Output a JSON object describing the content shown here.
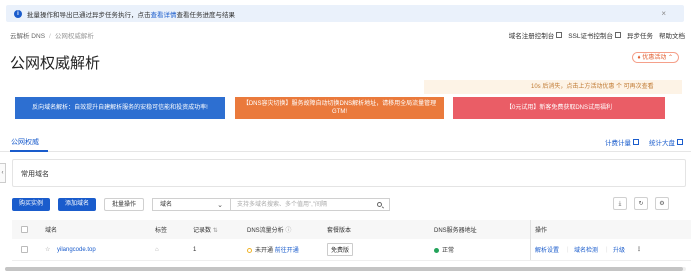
{
  "notice": {
    "text": "批量操作和导出已通过异步任务执行，点击",
    "link": "查看详情",
    "suffix": "查看任务进度与结果",
    "close": "×"
  },
  "breadcrumb": {
    "root": "云解析 DNS",
    "sep": "/",
    "current": "公网权威解析"
  },
  "top_links": [
    "域名注册控制台",
    "SSL证书控制台",
    "异步任务",
    "帮助文档"
  ],
  "page_title": "公网权威解析",
  "promo_badge": "优惠活动",
  "countdown": "10s 后消失，点击上方活动优惠 个 可再次查看",
  "banners": [
    "反向域名解析：自效提升自建解析服务的安稳可信能和投资成功率!",
    "【DNS容灾切换】服务故障自动切换DNS解析地址，请移用全局流量管理GTM!",
    "【0元试用】新客免费获取DNS试用福利"
  ],
  "tabs": {
    "active": "公网权威",
    "billing": "计费计量",
    "stats": "统计大盘"
  },
  "common_domain_label": "常用域名",
  "toolbar": {
    "buy": "购买实例",
    "add_domain": "添加域名",
    "batch": "批量操作",
    "select_value": "域名",
    "search_placeholder": "支持多域名搜索、多个值用\",\"间隔"
  },
  "table": {
    "headers": {
      "domain": "域名",
      "tag": "标签",
      "records": "记录数",
      "traffic": "DNS流量分析",
      "plan": "套餐版本",
      "dns_server": "DNS服务器地址",
      "ops": "操作"
    },
    "rows": [
      {
        "domain": "yilangcode.top",
        "records": "1",
        "traffic_status": "未开通",
        "traffic_action": "前往开通",
        "plan": "免费版",
        "dns_status": "正常",
        "ops": [
          "解析设置",
          "域名检测",
          "升级"
        ]
      }
    ]
  }
}
